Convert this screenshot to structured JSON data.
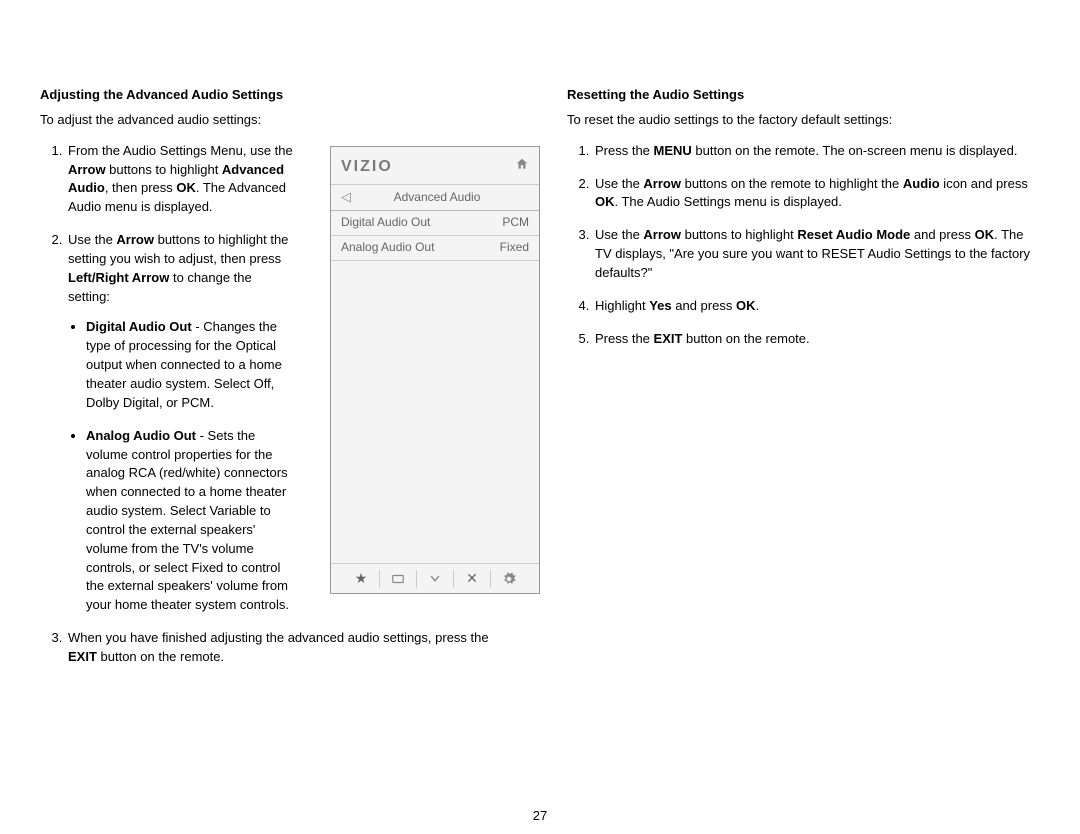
{
  "page_number": "27",
  "left": {
    "title": "Adjusting the Advanced Audio Settings",
    "intro": "To adjust the advanced audio settings:",
    "step1_a": "From the Audio Settings Menu, use the ",
    "step1_b_arrow": "Arrow",
    "step1_c": " buttons to highlight ",
    "step1_d_adv": "Advanced Audio",
    "step1_e": ", then press ",
    "step1_f_ok": "OK",
    "step1_g": ". The Advanced Audio menu is displayed.",
    "step2_a": "Use the ",
    "step2_b_arrow": "Arrow",
    "step2_c": " buttons to highlight the setting you wish to adjust, then press ",
    "step2_d_lr": "Left/Right Arrow",
    "step2_e": " to change the setting:",
    "bullet1_t": "Digital Audio Out",
    "bullet1_b": " - Changes the type of processing for the Optical output when connected to a home theater audio system. Select Off, Dolby Digital, or PCM.",
    "bullet2_t": "Analog Audio Out",
    "bullet2_b": " - Sets the volume control properties for the analog RCA (red/white) connectors when connected to a home theater audio system. Select Variable to control the external speakers' volume from the TV's volume controls, or select Fixed to control the external speakers' volume from your home theater system controls.",
    "step3_a": "When you have finished adjusting the advanced audio settings, press the ",
    "step3_b_exit": "EXIT",
    "step3_c": " button on the remote."
  },
  "right": {
    "title": "Resetting the Audio Settings",
    "intro": "To reset the audio settings to the factory default settings:",
    "step1_a": "Press the ",
    "step1_b_menu": "MENU",
    "step1_c": " button on the remote. The on-screen menu is displayed.",
    "step2_a": "Use the ",
    "step2_b_arrow": "Arrow",
    "step2_c": " buttons on the remote to highlight the ",
    "step2_d_audio": "Audio",
    "step2_e": " icon and press ",
    "step2_f_ok": "OK",
    "step2_g": ". The Audio Settings menu is displayed.",
    "step3_a": "Use the ",
    "step3_b_arrow": "Arrow",
    "step3_c": " buttons to highlight ",
    "step3_d_reset": "Reset Audio Mode",
    "step3_e": " and press ",
    "step3_f_ok": "OK",
    "step3_g": ". The TV displays, \"Are you sure you want to RESET Audio Settings to the factory defaults?\"",
    "step4_a": "Highlight ",
    "step4_b_yes": "Yes",
    "step4_c": " and press ",
    "step4_d_ok": "OK",
    "step4_e": ".",
    "step5_a": "Press the ",
    "step5_b_exit": "EXIT",
    "step5_c": " button on the remote."
  },
  "vizio": {
    "logo": "VIZIO",
    "tab": "Advanced Audio",
    "row1_label": "Digital Audio Out",
    "row1_value": "PCM",
    "row2_label": "Analog Audio Out",
    "row2_value": "Fixed"
  }
}
